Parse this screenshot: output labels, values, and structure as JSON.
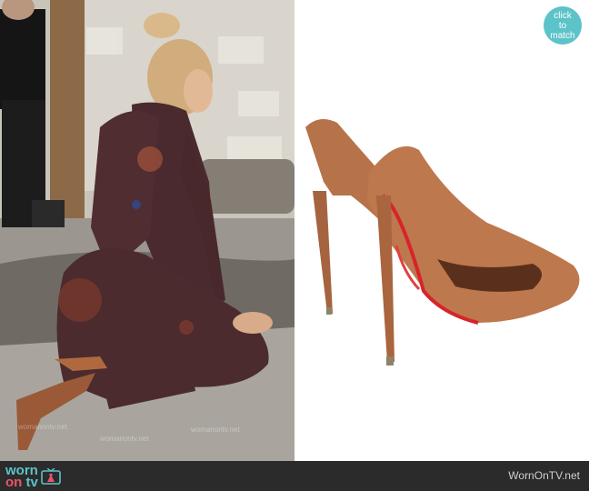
{
  "badge": {
    "line1": "click",
    "line2": "to",
    "line3": "match"
  },
  "watermark": "womanontv.net",
  "footer": {
    "logo_worn": "worn",
    "logo_on": "on",
    "logo_tv": "tv",
    "site": "WornOnTV.net"
  },
  "colors": {
    "accent": "#5cc3c9",
    "pink": "#e8556d",
    "footer_bg": "#2b2b2b",
    "shoe": "#b06a44",
    "sole": "#d8232a"
  }
}
